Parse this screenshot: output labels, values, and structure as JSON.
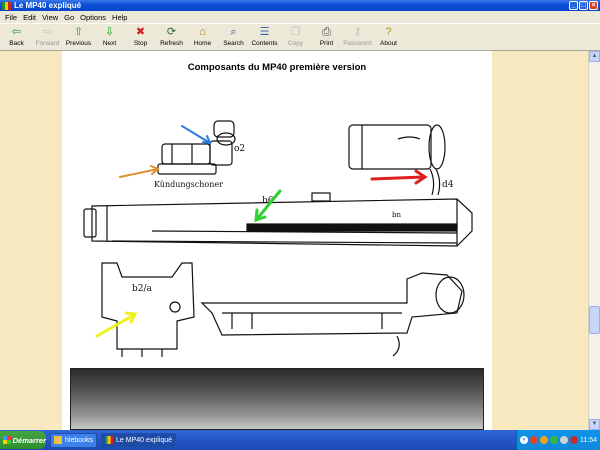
{
  "window": {
    "title": "Le MP40 expliqué"
  },
  "menu": [
    "File",
    "Edit",
    "View",
    "Go",
    "Options",
    "Help"
  ],
  "toolbar": [
    {
      "name": "back-button",
      "label": "Back",
      "icon": "back-arrow-icon",
      "glyph": "⇦",
      "color": "#2a8a3a",
      "enabled": true
    },
    {
      "name": "forward-button",
      "label": "Forward",
      "icon": "forward-arrow-icon",
      "glyph": "⇨",
      "color": "#888",
      "enabled": false
    },
    {
      "name": "previous-button",
      "label": "Previous",
      "icon": "up-arrow-icon",
      "glyph": "⇧",
      "color": "#1a9a2a",
      "enabled": true
    },
    {
      "name": "next-button",
      "label": "Next",
      "icon": "down-arrow-icon",
      "glyph": "⇩",
      "color": "#1a9a2a",
      "enabled": true
    },
    {
      "name": "stop-button",
      "label": "Stop",
      "icon": "stop-icon",
      "glyph": "✖",
      "color": "#d02020",
      "enabled": true
    },
    {
      "name": "refresh-button",
      "label": "Refresh",
      "icon": "refresh-icon",
      "glyph": "⟳",
      "color": "#2a6a2a",
      "enabled": true
    },
    {
      "name": "home-button",
      "label": "Home",
      "icon": "home-icon",
      "glyph": "⌂",
      "color": "#b07a20",
      "enabled": true
    },
    {
      "name": "search-button",
      "label": "Search",
      "icon": "search-icon",
      "glyph": "⌕",
      "color": "#2a4a8a",
      "enabled": true
    },
    {
      "name": "contents-button",
      "label": "Contents",
      "icon": "contents-icon",
      "glyph": "☰",
      "color": "#3a6ab0",
      "enabled": true
    },
    {
      "name": "copy-button",
      "label": "Copy",
      "icon": "copy-icon",
      "glyph": "❐",
      "color": "#888",
      "enabled": false
    },
    {
      "name": "print-button",
      "label": "Print",
      "icon": "print-icon",
      "glyph": "⎙",
      "color": "#444",
      "enabled": true
    },
    {
      "name": "password-button",
      "label": "Password",
      "icon": "key-icon",
      "glyph": "⚷",
      "color": "#888",
      "enabled": false
    },
    {
      "name": "about-button",
      "label": "About",
      "icon": "about-icon",
      "glyph": "?",
      "color": "#b09020",
      "enabled": true
    }
  ],
  "page": {
    "heading": "Composants du MP40 première version",
    "drawing_labels": {
      "ring_part": "o2",
      "handwritten_caption": "Kündungschoner",
      "lever_part": "d4",
      "barrel_part": "b6",
      "receiver_mark": "bn",
      "frame_part": "b2/a"
    }
  },
  "taskbar": {
    "start_label": "Démarrer",
    "tasks": [
      {
        "label": "hlebooks",
        "active": false
      },
      {
        "label": "Le MP40 expliqué",
        "active": true
      }
    ],
    "clock": "11:54"
  },
  "colors": {
    "accent": "#0a50d8",
    "page_bg": "#f8e8c0",
    "arrow_blue": "#2a7ae0",
    "arrow_orange": "#e0902a",
    "arrow_red": "#e02020",
    "arrow_green": "#30d030",
    "arrow_yellow": "#f0f020"
  }
}
